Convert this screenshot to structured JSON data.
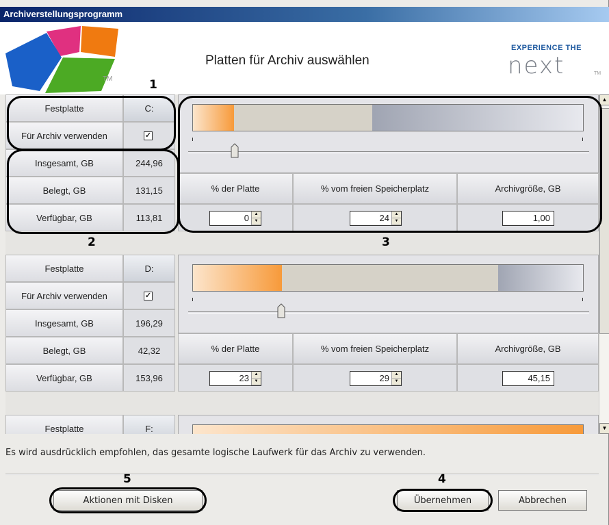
{
  "window": {
    "title": "Archiverstellungsprogramm"
  },
  "header": {
    "title": "Platten für Archiv auswählen",
    "logo_tm": "TM",
    "brand_tagline": "EXPERIENCE THE",
    "brand_name": "next",
    "brand_tm": "TM"
  },
  "labels": {
    "disk": "Festplatte",
    "use_for_archive": "Für Archiv verwenden",
    "total": "Insgesamt, GB",
    "used": "Belegt, GB",
    "free": "Verfügbar, GB",
    "pct_disk": "% der Platte",
    "pct_free": "% vom freien Speicherplatz",
    "archive_size": "Archivgröße, GB"
  },
  "disks": [
    {
      "letter": "C:",
      "use_checked": true,
      "total": "244,96",
      "used": "131,15",
      "free": "113,81",
      "pct_disk": "0",
      "pct_free": "24",
      "archive_size": "1,00",
      "archive_fraction": 0.1,
      "used_fraction": 0.46
    },
    {
      "letter": "D:",
      "use_checked": true,
      "total": "196,29",
      "used": "42,32",
      "free": "153,96",
      "pct_disk": "23",
      "pct_free": "29",
      "archive_size": "45,15",
      "archive_fraction": 0.23,
      "used_fraction": 0.22
    },
    {
      "letter": "F:",
      "archive_fraction": 1.0
    }
  ],
  "hint": "Es wird ausdrücklich empfohlen, das gesamte logische Laufwerk für das Archiv zu verwenden.",
  "buttons": {
    "disk_actions": "Aktionen mit Disken",
    "apply": "Übernehmen",
    "cancel": "Abbrechen"
  },
  "annotations": [
    "1",
    "2",
    "3",
    "4",
    "5"
  ],
  "colors": {
    "accent_orange": "#f79a3a",
    "title_bar": "#0a246a"
  }
}
